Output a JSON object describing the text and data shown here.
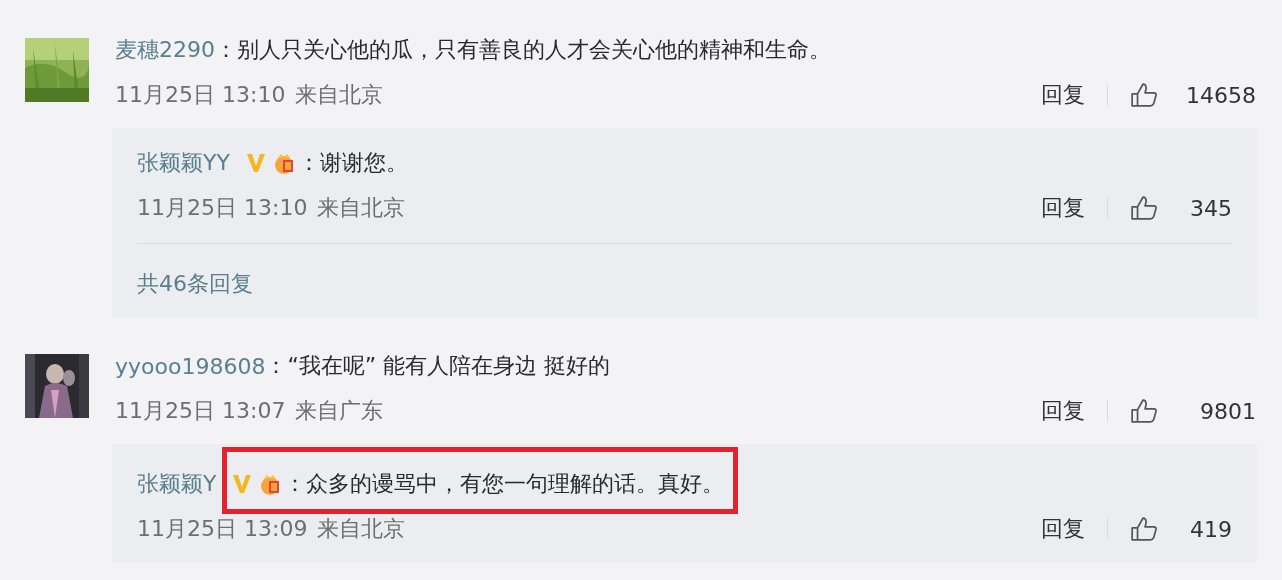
{
  "comments": [
    {
      "username": "麦穗2290",
      "text": "：别人只关心他的瓜，只有善良的人才会关心他的精神和生命。",
      "time": "11月25日 13:10",
      "location": "来自北京",
      "reply_label": "回复",
      "likes": "14658",
      "avatar": {
        "kind": "picture"
      },
      "replies": [
        {
          "username": "张颖颖YY",
          "verified": true,
          "member_badge": true,
          "text": "：谢谢您。",
          "time": "11月25日 13:10",
          "location": "来自北京",
          "reply_label": "回复",
          "likes": "345",
          "highlighted": false
        }
      ],
      "more_replies": "共46条回复"
    },
    {
      "username": "yyooo198608",
      "text": "：“我在呢” 能有人陪在身边 挺好的",
      "time": "11月25日 13:07",
      "location": "来自广东",
      "reply_label": "回复",
      "likes": "9801",
      "avatar": {
        "kind": "picture"
      },
      "replies": [
        {
          "username": "张颖颖Y",
          "verified": true,
          "member_badge": true,
          "text": "：众多的谩骂中，有您一句理解的话。真好。",
          "time": "11月25日 13:09",
          "location": "来自北京",
          "reply_label": "回复",
          "likes": "419",
          "highlighted": true
        }
      ]
    }
  ]
}
